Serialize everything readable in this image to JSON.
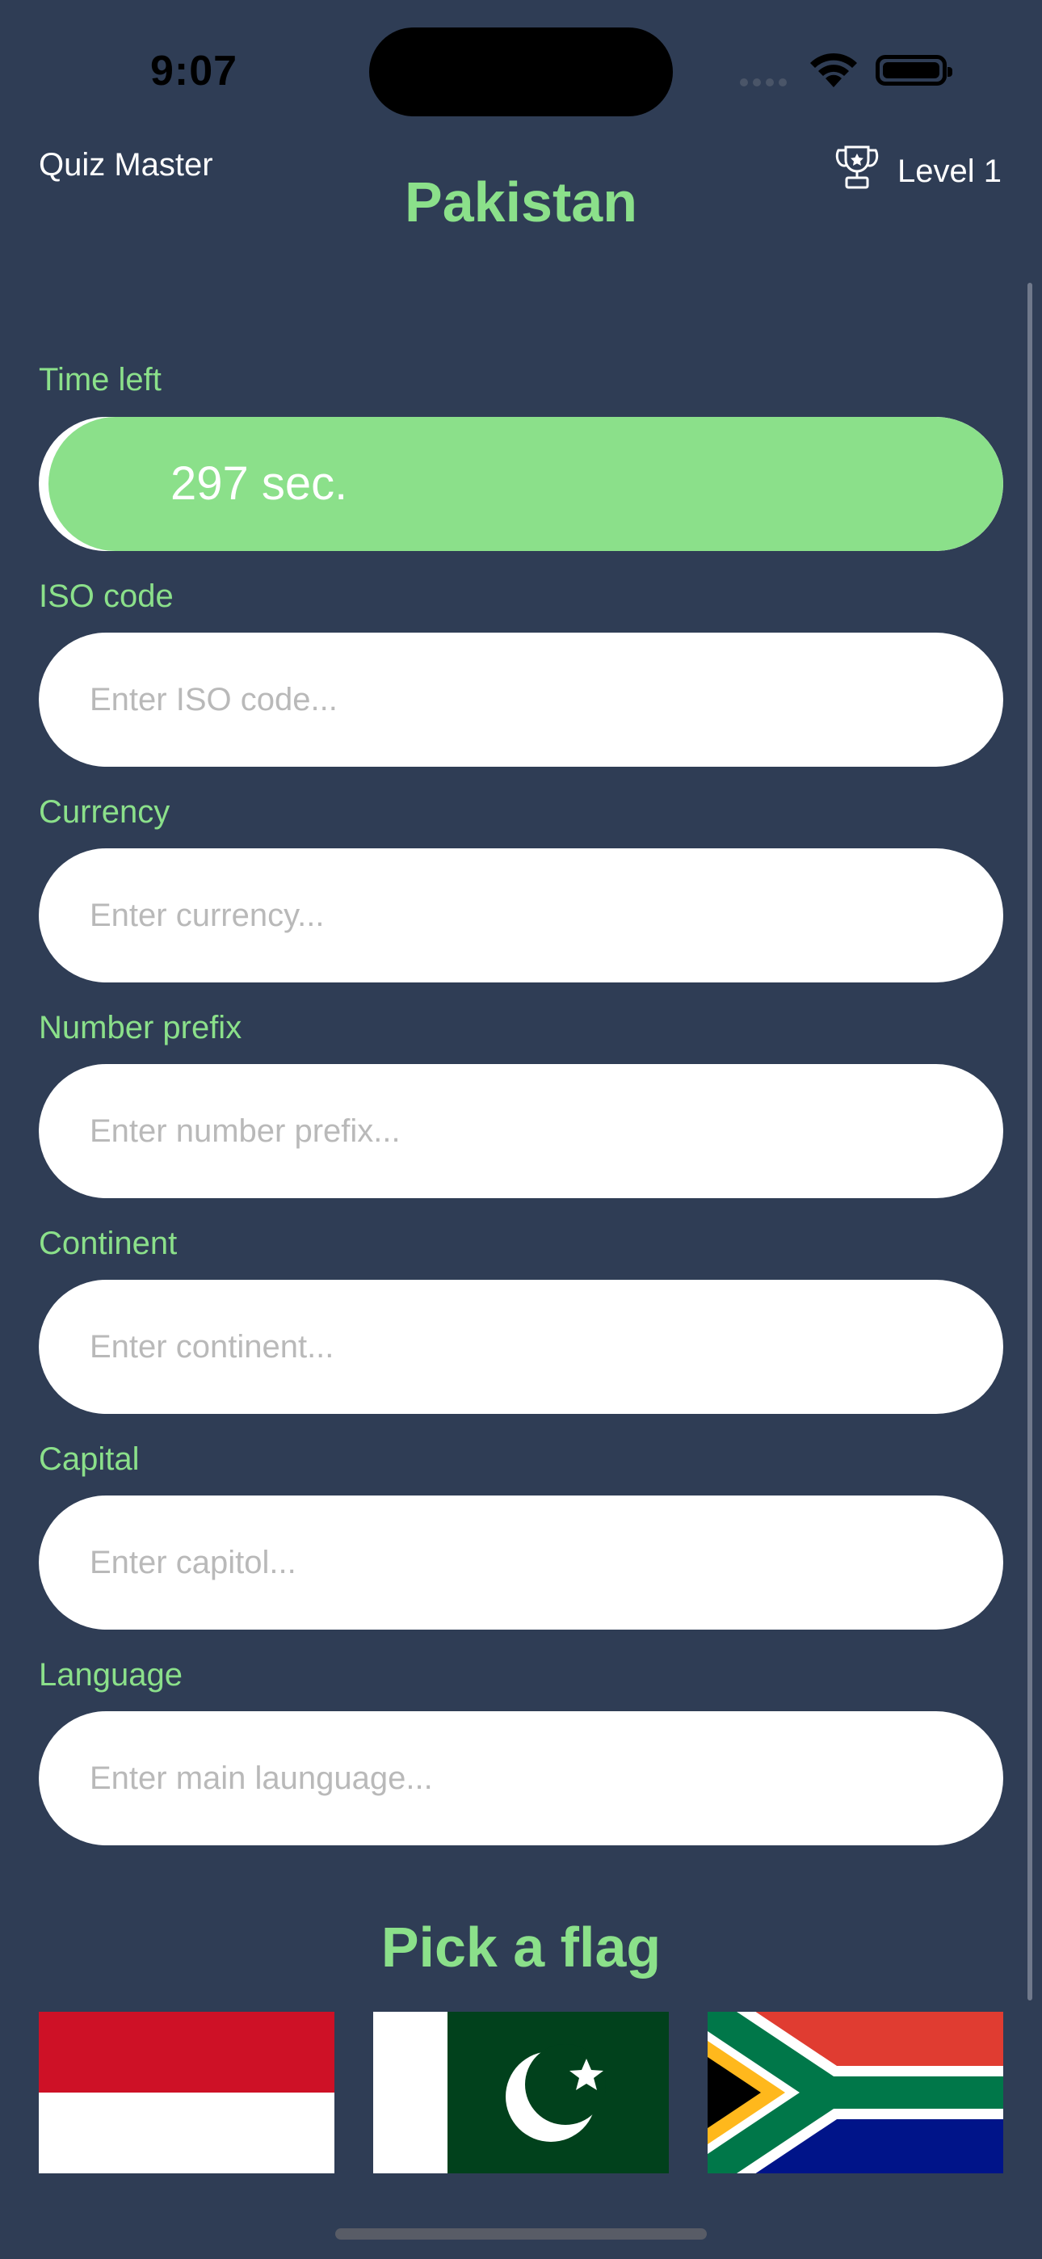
{
  "status_bar": {
    "time": "9:07"
  },
  "nav": {
    "title": "Quiz Master",
    "level_label": "Level 1",
    "trophy_icon": "trophy-icon"
  },
  "country": "Pakistan",
  "timer": {
    "label": "Time left",
    "text": "297 sec.",
    "remaining_fraction": 0.99
  },
  "fields": {
    "iso": {
      "label": "ISO code",
      "placeholder": "Enter ISO code..."
    },
    "currency": {
      "label": "Currency",
      "placeholder": "Enter currency..."
    },
    "prefix": {
      "label": "Number prefix",
      "placeholder": "Enter number prefix..."
    },
    "continent": {
      "label": "Continent",
      "placeholder": "Enter continent..."
    },
    "capital": {
      "label": "Capital",
      "placeholder": "Enter capitol..."
    },
    "language": {
      "label": "Language",
      "placeholder": "Enter main launguage..."
    }
  },
  "flags": {
    "heading": "Pick a flag",
    "options": [
      "indonesia-flag",
      "pakistan-flag",
      "south-africa-flag"
    ]
  },
  "colors": {
    "background": "#2f3d55",
    "accent": "#8be08a"
  }
}
